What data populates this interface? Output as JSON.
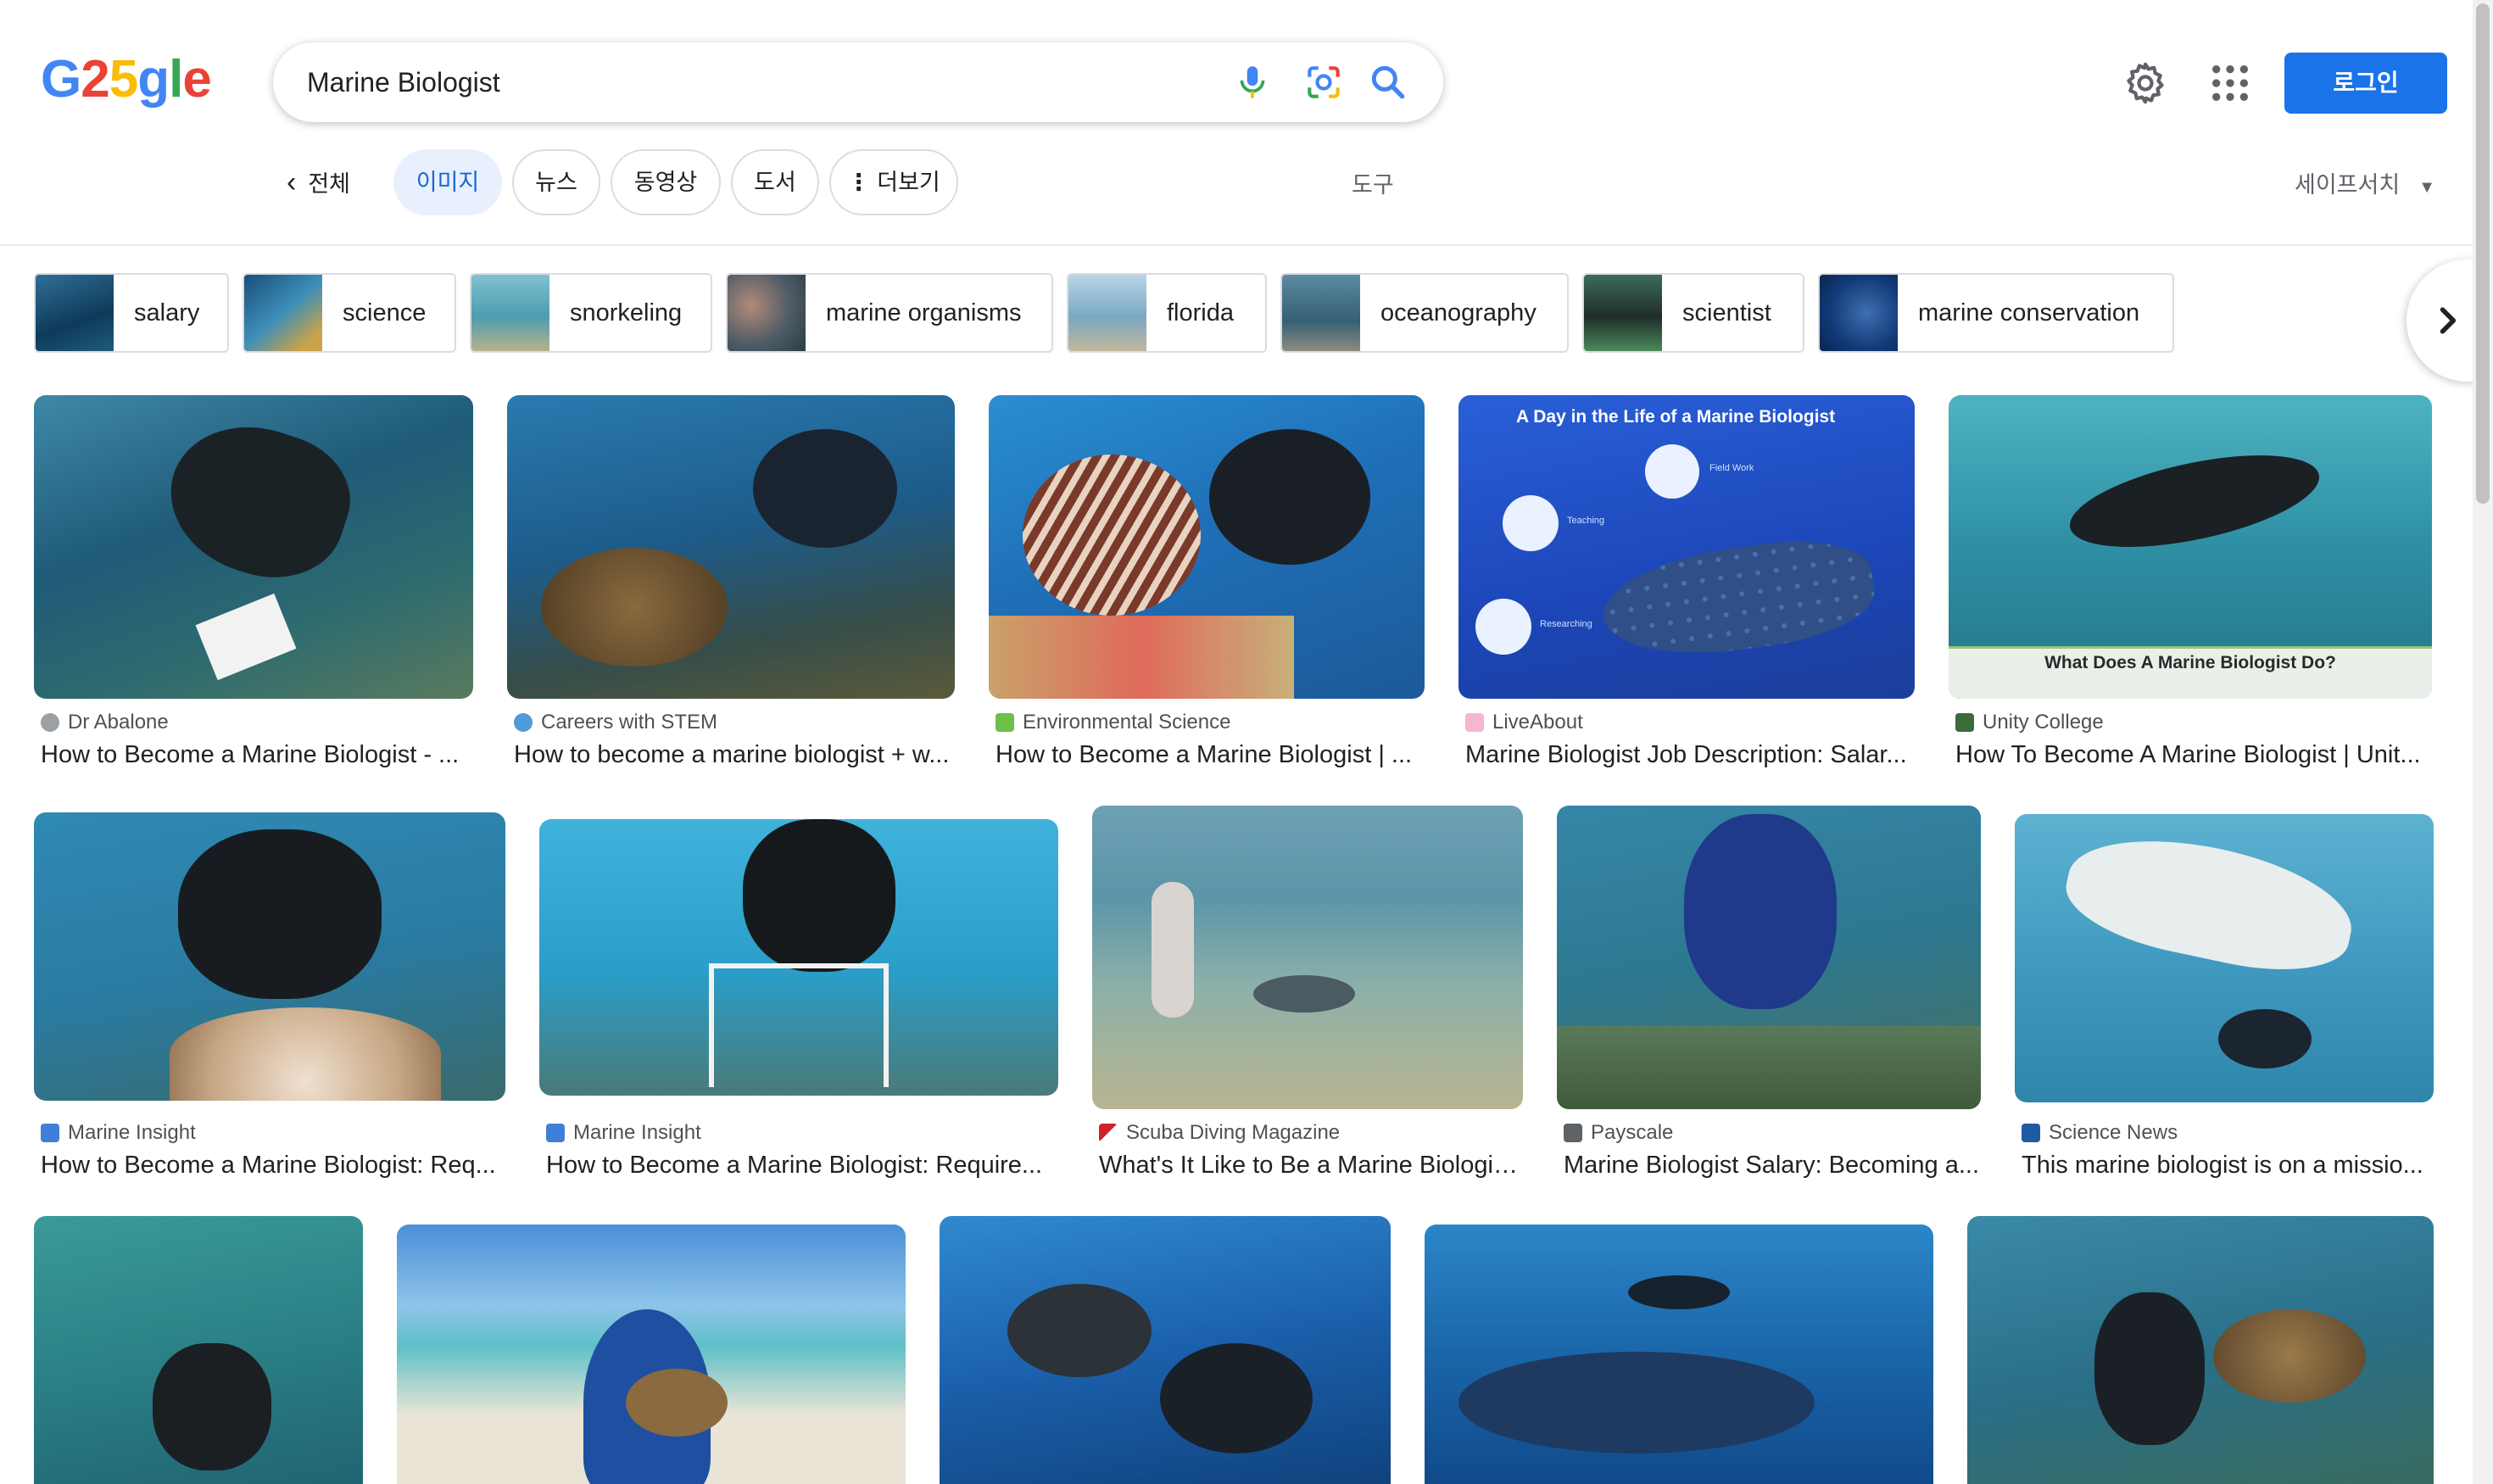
{
  "logo": {
    "letters": [
      "G",
      "2",
      "5",
      "g",
      "l",
      "e"
    ],
    "colors": [
      "#4285f4",
      "#ea4335",
      "#fbbc05",
      "#4285f4",
      "#34a853",
      "#ea4335"
    ]
  },
  "search": {
    "query": "Marine Biologist"
  },
  "header": {
    "login_label": "로그인"
  },
  "tabs": {
    "all": "전체",
    "images": "이미지",
    "news": "뉴스",
    "videos": "동영상",
    "books": "도서",
    "more": "더보기",
    "tools": "도구",
    "safesearch": "세이프서치"
  },
  "chips": [
    {
      "label": "salary"
    },
    {
      "label": "science"
    },
    {
      "label": "snorkeling"
    },
    {
      "label": "marine organisms"
    },
    {
      "label": "florida"
    },
    {
      "label": "oceanography"
    },
    {
      "label": "scientist"
    },
    {
      "label": "marine conservation"
    }
  ],
  "results": [
    {
      "source": "Dr Abalone",
      "title": "How to Become a Marine Biologist - ...",
      "overlay": ""
    },
    {
      "source": "Careers with STEM",
      "title": "How to become a marine biologist + w...",
      "overlay": ""
    },
    {
      "source": "Environmental Science",
      "title": "How to Become a Marine Biologist | ...",
      "overlay": ""
    },
    {
      "source": "LiveAbout",
      "title": "Marine Biologist Job Description: Salar...",
      "overlay": "A Day in the Life of a Marine Biologist",
      "overlay_labels": [
        "Field Work",
        "Teaching",
        "Researching"
      ]
    },
    {
      "source": "Unity College",
      "title": "How To Become A Marine Biologist | Unit...",
      "overlay": "What Does A Marine Biologist Do?"
    },
    {
      "source": "Marine Insight",
      "title": "How to Become a Marine Biologist: Req..."
    },
    {
      "source": "Marine Insight",
      "title": "How to Become a Marine Biologist: Require..."
    },
    {
      "source": "Scuba Diving Magazine",
      "title": "What's It Like to Be a Marine Biologis..."
    },
    {
      "source": "Payscale",
      "title": "Marine Biologist Salary: Becoming a..."
    },
    {
      "source": "Science News",
      "title": "This marine biologist is on a missio..."
    }
  ],
  "colors": {
    "accent": "#1a73e8",
    "active_tab_bg": "#e8f0fe",
    "active_tab_text": "#1967d2"
  }
}
